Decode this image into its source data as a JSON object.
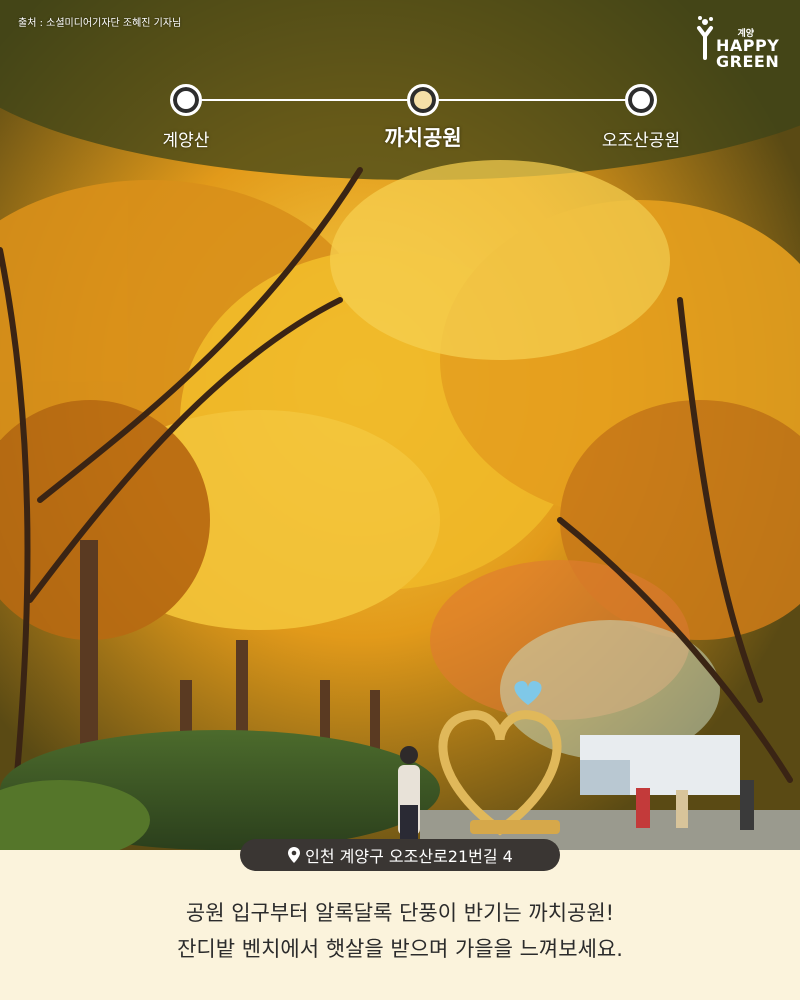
{
  "credit": "출처 : 소셜미디어기자단 조혜진 기자님",
  "logo": {
    "small": "계양",
    "line1": "HAPPY",
    "line2": "GREEN"
  },
  "route": {
    "stops": [
      {
        "label": "계양산",
        "active": false
      },
      {
        "label": "까치공원",
        "active": true
      },
      {
        "label": "오조산공원",
        "active": false
      }
    ]
  },
  "address": "인천 계양구 오조산로21번길 4",
  "caption": {
    "line1": "공원 입구부터 알록달록 단풍이 반기는 까치공원!",
    "line2": "잔디밭 벤치에서 햇살을 받으며 가을을 느껴보세요."
  },
  "colors": {
    "background": "#fbf3dc",
    "badge": "#3a3633",
    "active_dot": "#f5dfa8"
  }
}
